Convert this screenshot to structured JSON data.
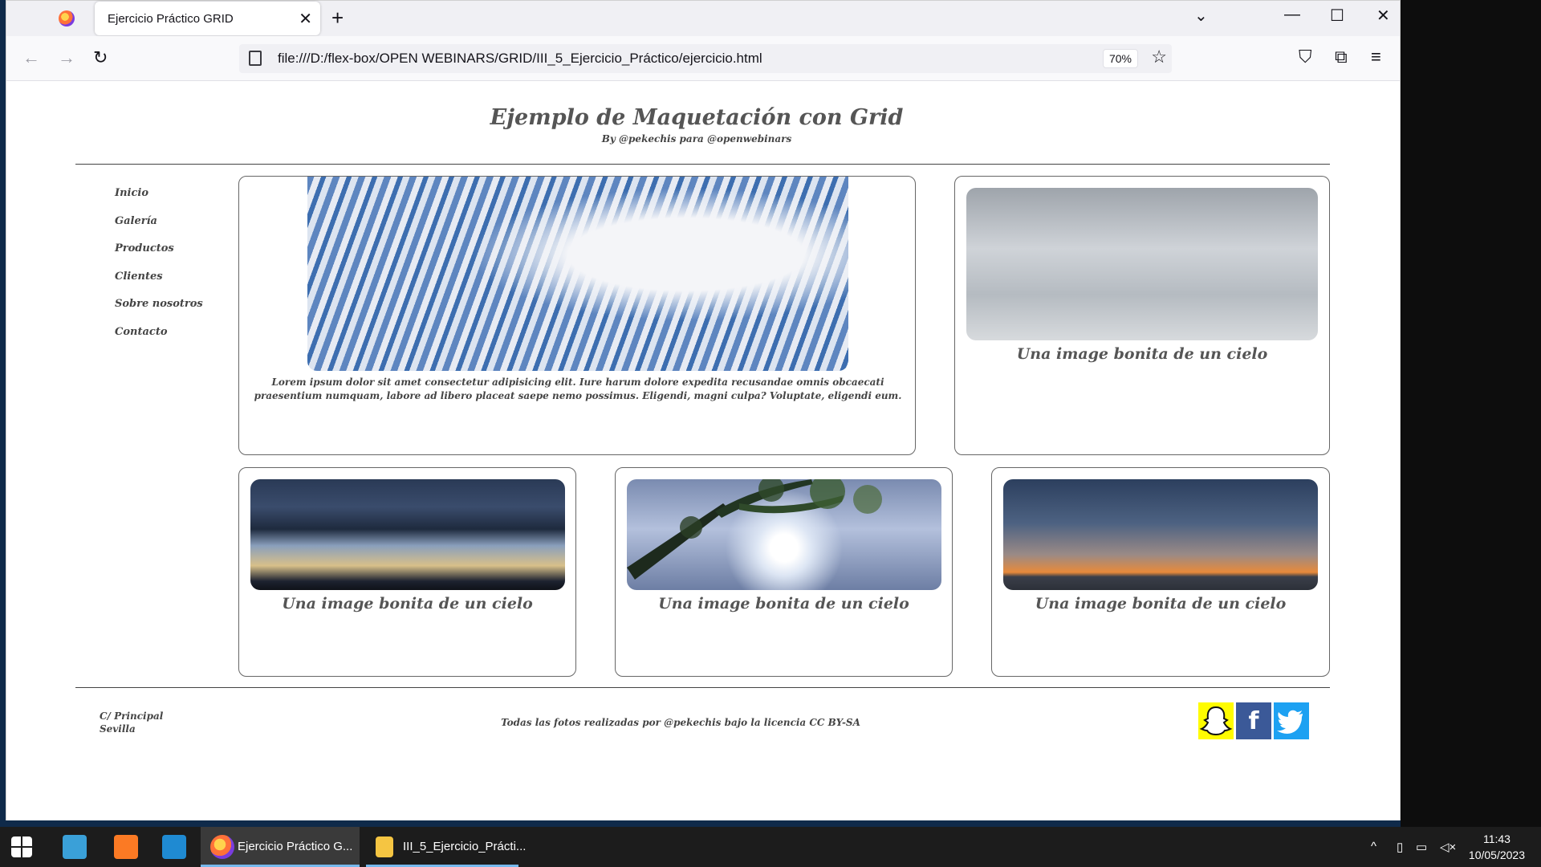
{
  "browser": {
    "tab_title": "Ejercicio Práctico GRID",
    "url": "file:///D:/flex-box/OPEN WEBINARS/GRID/III_5_Ejercicio_Práctico/ejercicio.html",
    "zoom": "70%"
  },
  "page": {
    "title": "Ejemplo de Maquetación con Grid",
    "byline": "By @pekechis para @openwebinars",
    "menu": [
      "Inicio",
      "Galería",
      "Productos",
      "Clientes",
      "Sobre nosotros",
      "Contacto"
    ],
    "main_text": "Lorem ipsum dolor sit amet consectetur adipisicing elit. Iure harum dolore expedita recusandae omnis obcaecati praesentium numquam, labore ad libero placeat saepe nemo possimus. Eligendi, magni culpa? Voluptate, eligendi eum.",
    "captions": [
      "Una image bonita de un cielo",
      "Una image bonita de un cielo",
      "Una image bonita de un cielo",
      "Una image bonita de un cielo"
    ],
    "footer": {
      "address_line1": "C/ Principal",
      "address_line2": "Sevilla",
      "credits": "Todas las fotos realizadas por @pekechis bajo la licencia CC BY-SA"
    },
    "social_icons": [
      "snapchat-icon",
      "facebook-icon",
      "twitter-icon"
    ]
  },
  "taskbar": {
    "items": [
      "Ejercicio Práctico G...",
      "III_5_Ejercicio_Prácti..."
    ],
    "time": "11:43",
    "date": "10/05/2023"
  }
}
